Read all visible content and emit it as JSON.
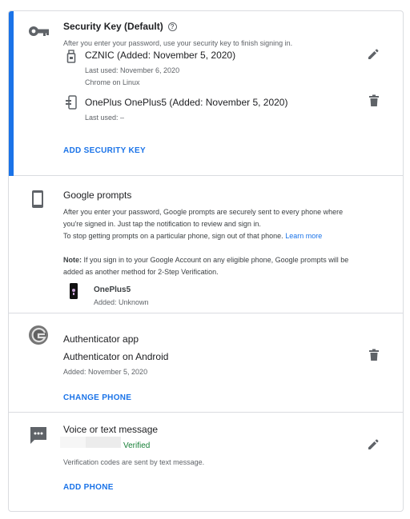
{
  "security_key": {
    "title": "Security Key (Default)",
    "description": "After you enter your password, use your security key to finish signing in.",
    "keys": [
      {
        "name": "CZNIC (Added: November 5, 2020)",
        "last_used": "Last used: November 6, 2020",
        "browser": "Chrome on Linux"
      },
      {
        "name": "OnePlus OnePlus5 (Added: November 5, 2020)",
        "last_used": "Last used: –"
      }
    ],
    "add_label": "ADD SECURITY KEY"
  },
  "google_prompts": {
    "title": "Google prompts",
    "line1": "After you enter your password, Google prompts are securely sent to every phone where",
    "line2": "you're signed in. Just tap the notification to review and sign in.",
    "line3": "To stop getting prompts on a particular phone, sign out of that phone.",
    "learn_more": "Learn more",
    "note_label": "Note:",
    "note_line1": " If you sign in to your Google Account on any eligible phone, Google prompts will be",
    "note_line2": "added as another method for 2-Step Verification.",
    "device": {
      "name": "OnePlus5",
      "added": "Added: Unknown"
    }
  },
  "authenticator": {
    "title": "Authenticator app",
    "device": "Authenticator on Android",
    "added": "Added: November 5, 2020",
    "change_label": "CHANGE PHONE"
  },
  "sms": {
    "title": "Voice or text message",
    "status": "Verified",
    "description": "Verification codes are sent by text message.",
    "add_label": "ADD PHONE"
  },
  "colors": {
    "accent": "#1a73e8",
    "verified": "#188038",
    "icon": "#5f6368"
  },
  "icons": [
    "key-icon",
    "help-icon",
    "usb-key-icon",
    "edit-icon",
    "phone-key-icon",
    "delete-icon",
    "phone-icon",
    "phone-thumbnail-icon",
    "authenticator-icon",
    "message-icon"
  ]
}
